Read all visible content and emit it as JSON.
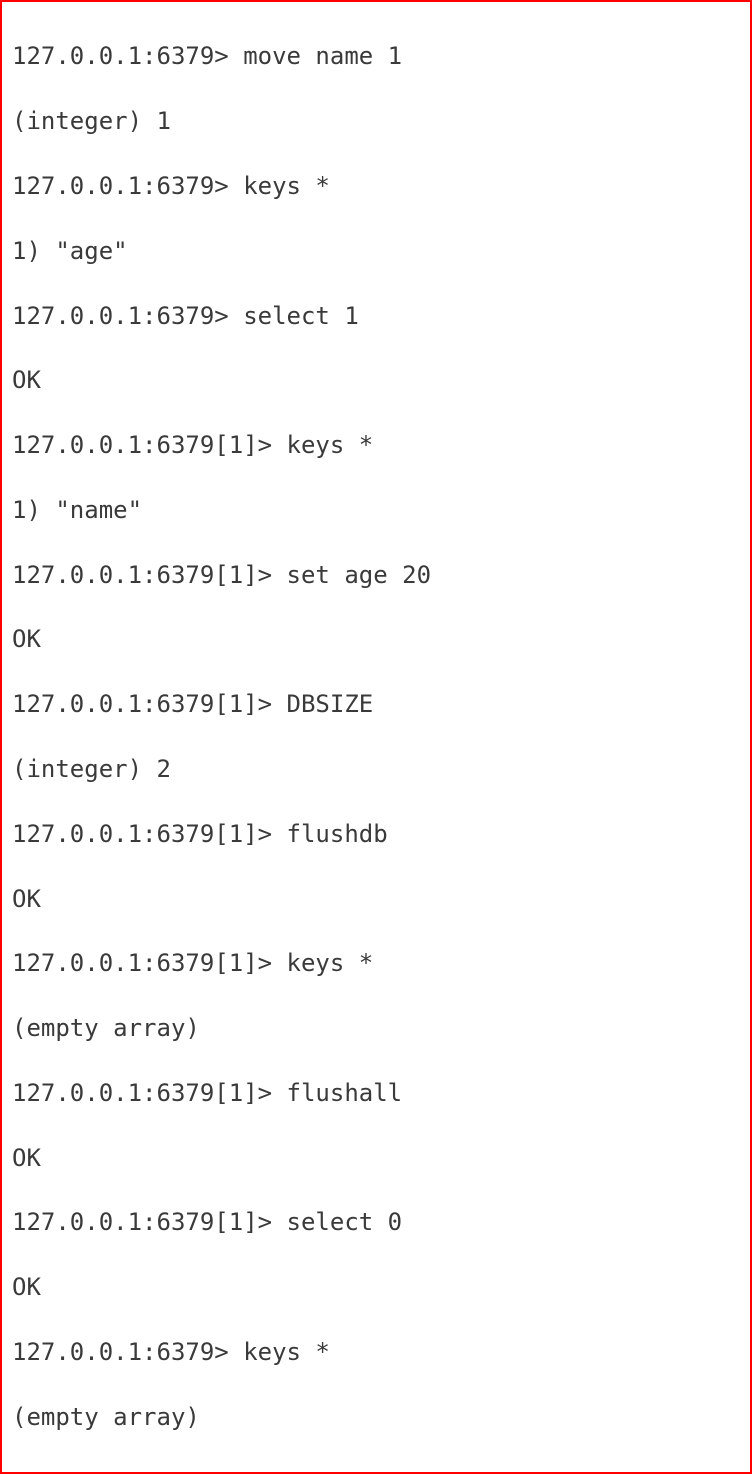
{
  "terminal": {
    "lines": [
      "127.0.0.1:6379> move name 1",
      "(integer) 1",
      "127.0.0.1:6379> keys *",
      "1) \"age\"",
      "127.0.0.1:6379> select 1",
      "OK",
      "127.0.0.1:6379[1]> keys *",
      "1) \"name\"",
      "127.0.0.1:6379[1]> set age 20",
      "OK",
      "127.0.0.1:6379[1]> DBSIZE",
      "(integer) 2",
      "127.0.0.1:6379[1]> flushdb",
      "OK",
      "127.0.0.1:6379[1]> keys *",
      "(empty array)",
      "127.0.0.1:6379[1]> flushall",
      "OK",
      "127.0.0.1:6379[1]> select 0",
      "OK",
      "127.0.0.1:6379> keys *",
      "(empty array)"
    ]
  }
}
